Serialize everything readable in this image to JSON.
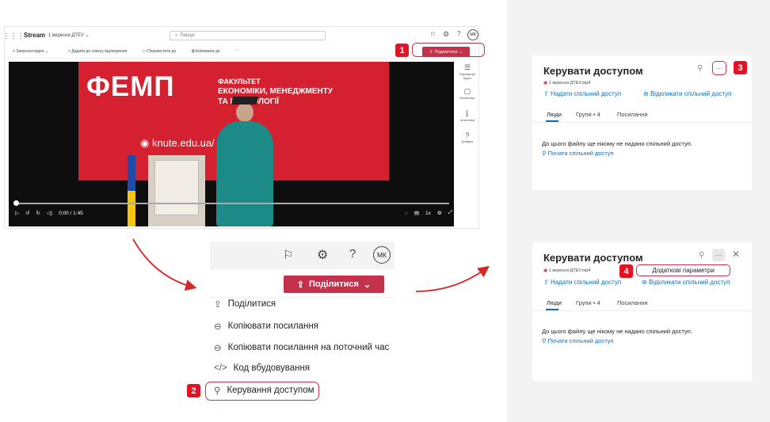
{
  "stream": {
    "app_name": "Stream",
    "file_crumb": "1 вересня ДТЕУ ",
    "search_placeholder": "Пошук",
    "avatar": "МК",
    "toolbar": [
      "Записати відео",
      "Додати до списку відтворення",
      "Перемістити до",
      "Копіювати до"
    ],
    "share_label": "Поділитися",
    "right_rail": [
      "Параметри відео",
      "Коментарі",
      "Аналітика",
      "Довідка"
    ],
    "time": "0:00 / 1:45",
    "speed": "1x",
    "video_text": {
      "logo": "ФЕМП",
      "line1": "ФАКУЛЬТЕТ",
      "line2": "ЕКОНОМІКИ, МЕНЕДЖМЕНТУ",
      "line3": "ТА ПСИХОЛОГІЇ",
      "url": "knute.edu.ua/"
    }
  },
  "menu": {
    "avatar": "МК",
    "share_label": "Поділитися",
    "items": [
      {
        "icon": "share-icon",
        "label": "Поділитися"
      },
      {
        "icon": "link-icon",
        "label": "Копіювати посилання"
      },
      {
        "icon": "link-icon",
        "label": "Копіювати посилання на поточний час"
      },
      {
        "icon": "code-icon",
        "label": "Код вбудовування"
      },
      {
        "icon": "person-key-icon",
        "label": "Керування доступом"
      }
    ]
  },
  "manage_panel_1": {
    "title": "Керувати доступом",
    "file": "1 вересня ДТЕУ.mp4",
    "grant": "Надати спільний доступ",
    "revoke": "Відкликати спільний доступ",
    "tabs": [
      "Люди",
      "Групи • 4",
      "Посилання"
    ],
    "empty": "До цього файлу ще нікому не надано спільний доступ.",
    "start": "Почати спільний доступ"
  },
  "manage_panel_2": {
    "title": "Керувати доступом",
    "file": "1 вересня ДТЕУ.mp4",
    "more_options": "Додаткові параметри",
    "grant": "Надати спільний доступ",
    "revoke": "Відкликати спільний доступ",
    "tabs": [
      "Люди",
      "Групи • 4",
      "Посилання"
    ],
    "empty": "До цього файлу ще нікому не надано спільний доступ.",
    "start": "Почати спільний доступ"
  },
  "steps": [
    "1",
    "2",
    "3",
    "4"
  ],
  "colors": {
    "accent": "#c4314b",
    "marker": "#e81123",
    "link": "#0f6cbd",
    "video_red": "#d4202f"
  }
}
